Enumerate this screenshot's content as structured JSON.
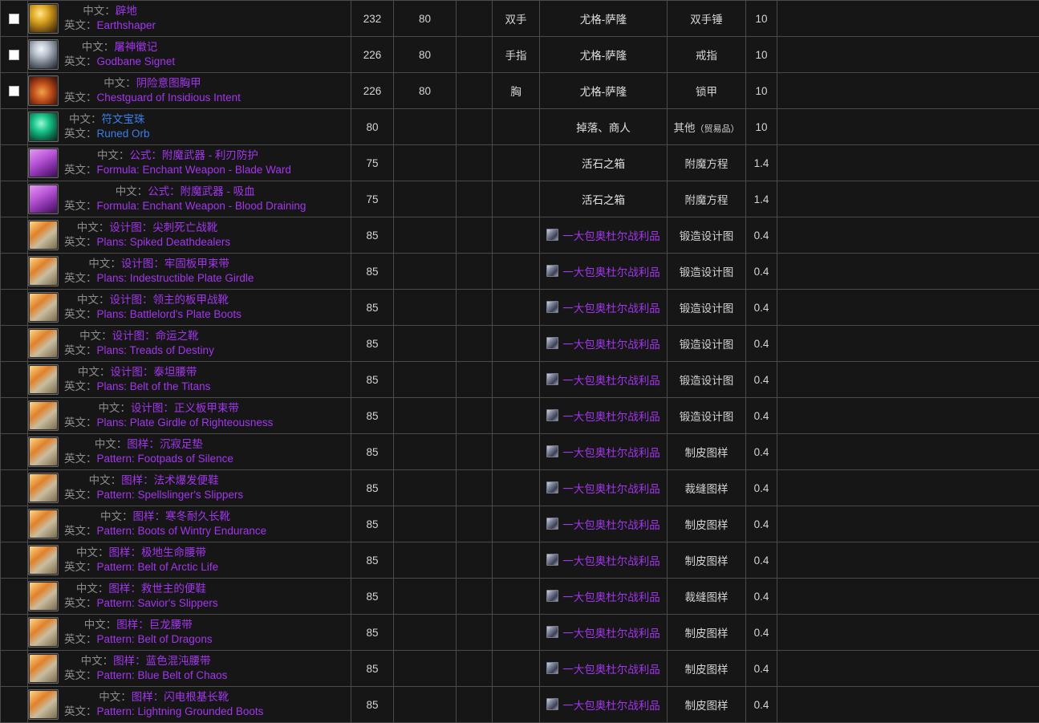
{
  "labels": {
    "cn": "中文：",
    "en": "英文："
  },
  "colors": {
    "epic": "#a335ee",
    "rare": "#3a7fe8",
    "background": "#161616",
    "border": "#4a4a4a",
    "label_gray": "#8d8d8d"
  },
  "columns": [
    "checkbox",
    "item",
    "item_level",
    "required_level",
    "blank",
    "slot",
    "source",
    "type",
    "value",
    "notes"
  ],
  "rows": [
    {
      "checkbox": true,
      "checked": false,
      "icon": "two-handed-mace-icon",
      "icon_css": "radial-gradient(circle at 38% 32%, #ffe98a 0%, #d9a21f 35%, #6d4a10 75%, #2a1d06 100%)",
      "quality": "epic",
      "name_cn": "辟地",
      "name_en": "Earthshaper",
      "item_level": "232",
      "required_level": "80",
      "blank": "",
      "slot": "双手",
      "source": "尤格-萨隆",
      "source_link": false,
      "type": "双手锤",
      "type_sub": "",
      "value": "10",
      "notes": ""
    },
    {
      "checkbox": true,
      "checked": false,
      "icon": "ring-icon",
      "icon_css": "radial-gradient(circle at 42% 30%, #f4f7fb 0%, #b9c2cc 30%, #656e78 65%, #1c2127 100%)",
      "quality": "epic",
      "name_cn": "屠神徽记",
      "name_en": "Godbane Signet",
      "item_level": "226",
      "required_level": "80",
      "blank": "",
      "slot": "手指",
      "source": "尤格-萨隆",
      "source_link": false,
      "type": "戒指",
      "type_sub": "",
      "value": "10",
      "notes": ""
    },
    {
      "checkbox": true,
      "checked": false,
      "icon": "chest-armor-icon",
      "icon_css": "radial-gradient(circle at 45% 55%, #f0a24a 0%, #c2521d 40%, #7a2a10 70%, #2a1207 100%)",
      "quality": "epic",
      "name_cn": "阴险意图胸甲",
      "name_en": "Chestguard of Insidious Intent",
      "item_level": "226",
      "required_level": "80",
      "blank": "",
      "slot": "胸",
      "source": "尤格-萨隆",
      "source_link": false,
      "type": "锁甲",
      "type_sub": "",
      "value": "10",
      "notes": ""
    },
    {
      "checkbox": false,
      "checked": false,
      "icon": "runed-orb-icon",
      "icon_css": "radial-gradient(circle at 42% 38%, #9ff7d6 0%, #19c48a 35%, #0c6a4a 70%, #08281f 100%)",
      "quality": "rare",
      "name_cn": "符文宝珠",
      "name_en": "Runed Orb",
      "item_level": "80",
      "required_level": "",
      "blank": "",
      "slot": "",
      "source": "掉落、商人",
      "source_link": false,
      "type": "其他",
      "type_sub": "（贸易品）",
      "value": "10",
      "notes": ""
    },
    {
      "checkbox": false,
      "checked": false,
      "icon": "enchanting-formula-icon",
      "icon_css": "linear-gradient(150deg, #e29bf0 0%, #b955d6 40%, #7a2a9c 72%, #3a1150 100%)",
      "quality": "epic",
      "name_cn": "公式：附魔武器 - 利刃防护",
      "name_en": "Formula: Enchant Weapon - Blade Ward",
      "item_level": "75",
      "required_level": "",
      "blank": "",
      "slot": "",
      "source": "活石之箱",
      "source_link": false,
      "type": "附魔方程",
      "type_sub": "",
      "value": "1.4",
      "notes": ""
    },
    {
      "checkbox": false,
      "checked": false,
      "icon": "enchanting-formula-icon",
      "icon_css": "linear-gradient(150deg, #e29bf0 0%, #b955d6 40%, #7a2a9c 72%, #3a1150 100%)",
      "quality": "epic",
      "name_cn": "公式：附魔武器 - 吸血",
      "name_en": "Formula: Enchant Weapon - Blood Draining",
      "item_level": "75",
      "required_level": "",
      "blank": "",
      "slot": "",
      "source": "活石之箱",
      "source_link": false,
      "type": "附魔方程",
      "type_sub": "",
      "value": "1.4",
      "notes": ""
    },
    {
      "checkbox": false,
      "checked": false,
      "icon": "blacksmithing-plans-icon",
      "icon_css": "linear-gradient(140deg, #ffd98a 0%, #e0812a 35%, #c9bda0 60%, #7a6a4c 100%)",
      "quality": "epic",
      "name_cn": "设计图：尖刺死亡战靴",
      "name_en": "Plans: Spiked Deathdealers",
      "item_level": "85",
      "required_level": "",
      "blank": "",
      "slot": "",
      "source": "一大包奥杜尔战利品",
      "source_link": true,
      "type": "锻造设计图",
      "type_sub": "",
      "value": "0.4",
      "notes": ""
    },
    {
      "checkbox": false,
      "checked": false,
      "icon": "blacksmithing-plans-icon",
      "icon_css": "linear-gradient(140deg, #ffd98a 0%, #e0812a 35%, #c9bda0 60%, #7a6a4c 100%)",
      "quality": "epic",
      "name_cn": "设计图：牢固板甲束带",
      "name_en": "Plans: Indestructible Plate Girdle",
      "item_level": "85",
      "required_level": "",
      "blank": "",
      "slot": "",
      "source": "一大包奥杜尔战利品",
      "source_link": true,
      "type": "锻造设计图",
      "type_sub": "",
      "value": "0.4",
      "notes": ""
    },
    {
      "checkbox": false,
      "checked": false,
      "icon": "blacksmithing-plans-icon",
      "icon_css": "linear-gradient(140deg, #ffd98a 0%, #e0812a 35%, #c9bda0 60%, #7a6a4c 100%)",
      "quality": "epic",
      "name_cn": "设计图：领主的板甲战靴",
      "name_en": "Plans: Battlelord's Plate Boots",
      "item_level": "85",
      "required_level": "",
      "blank": "",
      "slot": "",
      "source": "一大包奥杜尔战利品",
      "source_link": true,
      "type": "锻造设计图",
      "type_sub": "",
      "value": "0.4",
      "notes": ""
    },
    {
      "checkbox": false,
      "checked": false,
      "icon": "blacksmithing-plans-icon",
      "icon_css": "linear-gradient(140deg, #ffd98a 0%, #e0812a 35%, #c9bda0 60%, #7a6a4c 100%)",
      "quality": "epic",
      "name_cn": "设计图：命运之靴",
      "name_en": "Plans: Treads of Destiny",
      "item_level": "85",
      "required_level": "",
      "blank": "",
      "slot": "",
      "source": "一大包奥杜尔战利品",
      "source_link": true,
      "type": "锻造设计图",
      "type_sub": "",
      "value": "0.4",
      "notes": ""
    },
    {
      "checkbox": false,
      "checked": false,
      "icon": "blacksmithing-plans-icon",
      "icon_css": "linear-gradient(140deg, #ffd98a 0%, #e0812a 35%, #c9bda0 60%, #7a6a4c 100%)",
      "quality": "epic",
      "name_cn": "设计图：泰坦腰带",
      "name_en": "Plans: Belt of the Titans",
      "item_level": "85",
      "required_level": "",
      "blank": "",
      "slot": "",
      "source": "一大包奥杜尔战利品",
      "source_link": true,
      "type": "锻造设计图",
      "type_sub": "",
      "value": "0.4",
      "notes": ""
    },
    {
      "checkbox": false,
      "checked": false,
      "icon": "blacksmithing-plans-icon",
      "icon_css": "linear-gradient(140deg, #ffd98a 0%, #e0812a 35%, #c9bda0 60%, #7a6a4c 100%)",
      "quality": "epic",
      "name_cn": "设计图：正义板甲束带",
      "name_en": "Plans: Plate Girdle of Righteousness",
      "item_level": "85",
      "required_level": "",
      "blank": "",
      "slot": "",
      "source": "一大包奥杜尔战利品",
      "source_link": true,
      "type": "锻造设计图",
      "type_sub": "",
      "value": "0.4",
      "notes": ""
    },
    {
      "checkbox": false,
      "checked": false,
      "icon": "leatherworking-pattern-icon",
      "icon_css": "linear-gradient(140deg, #ffd98a 0%, #e0812a 35%, #c9bda0 60%, #7a6a4c 100%)",
      "quality": "epic",
      "name_cn": "图样：沉寂足垫",
      "name_en": "Pattern: Footpads of Silence",
      "item_level": "85",
      "required_level": "",
      "blank": "",
      "slot": "",
      "source": "一大包奥杜尔战利品",
      "source_link": true,
      "type": "制皮图样",
      "type_sub": "",
      "value": "0.4",
      "notes": ""
    },
    {
      "checkbox": false,
      "checked": false,
      "icon": "tailoring-pattern-icon",
      "icon_css": "linear-gradient(140deg, #ffd98a 0%, #e0812a 35%, #c9bda0 60%, #7a6a4c 100%)",
      "quality": "epic",
      "name_cn": "图样：法术爆发便鞋",
      "name_en": "Pattern: Spellslinger's Slippers",
      "item_level": "85",
      "required_level": "",
      "blank": "",
      "slot": "",
      "source": "一大包奥杜尔战利品",
      "source_link": true,
      "type": "裁缝图样",
      "type_sub": "",
      "value": "0.4",
      "notes": ""
    },
    {
      "checkbox": false,
      "checked": false,
      "icon": "leatherworking-pattern-icon",
      "icon_css": "linear-gradient(140deg, #ffd98a 0%, #e0812a 35%, #c9bda0 60%, #7a6a4c 100%)",
      "quality": "epic",
      "name_cn": "图样：寒冬耐久长靴",
      "name_en": "Pattern: Boots of Wintry Endurance",
      "item_level": "85",
      "required_level": "",
      "blank": "",
      "slot": "",
      "source": "一大包奥杜尔战利品",
      "source_link": true,
      "type": "制皮图样",
      "type_sub": "",
      "value": "0.4",
      "notes": ""
    },
    {
      "checkbox": false,
      "checked": false,
      "icon": "leatherworking-pattern-icon",
      "icon_css": "linear-gradient(140deg, #ffd98a 0%, #e0812a 35%, #c9bda0 60%, #7a6a4c 100%)",
      "quality": "epic",
      "name_cn": "图样：极地生命腰带",
      "name_en": "Pattern: Belt of Arctic Life",
      "item_level": "85",
      "required_level": "",
      "blank": "",
      "slot": "",
      "source": "一大包奥杜尔战利品",
      "source_link": true,
      "type": "制皮图样",
      "type_sub": "",
      "value": "0.4",
      "notes": ""
    },
    {
      "checkbox": false,
      "checked": false,
      "icon": "tailoring-pattern-icon",
      "icon_css": "linear-gradient(140deg, #ffd98a 0%, #e0812a 35%, #c9bda0 60%, #7a6a4c 100%)",
      "quality": "epic",
      "name_cn": "图样：救世主的便鞋",
      "name_en": "Pattern: Savior's Slippers",
      "item_level": "85",
      "required_level": "",
      "blank": "",
      "slot": "",
      "source": "一大包奥杜尔战利品",
      "source_link": true,
      "type": "裁缝图样",
      "type_sub": "",
      "value": "0.4",
      "notes": ""
    },
    {
      "checkbox": false,
      "checked": false,
      "icon": "leatherworking-pattern-icon",
      "icon_css": "linear-gradient(140deg, #ffd98a 0%, #e0812a 35%, #c9bda0 60%, #7a6a4c 100%)",
      "quality": "epic",
      "name_cn": "图样：巨龙腰带",
      "name_en": "Pattern: Belt of Dragons",
      "item_level": "85",
      "required_level": "",
      "blank": "",
      "slot": "",
      "source": "一大包奥杜尔战利品",
      "source_link": true,
      "type": "制皮图样",
      "type_sub": "",
      "value": "0.4",
      "notes": ""
    },
    {
      "checkbox": false,
      "checked": false,
      "icon": "leatherworking-pattern-icon",
      "icon_css": "linear-gradient(140deg, #ffd98a 0%, #e0812a 35%, #c9bda0 60%, #7a6a4c 100%)",
      "quality": "epic",
      "name_cn": "图样：蓝色混沌腰带",
      "name_en": "Pattern: Blue Belt of Chaos",
      "item_level": "85",
      "required_level": "",
      "blank": "",
      "slot": "",
      "source": "一大包奥杜尔战利品",
      "source_link": true,
      "type": "制皮图样",
      "type_sub": "",
      "value": "0.4",
      "notes": ""
    },
    {
      "checkbox": false,
      "checked": false,
      "icon": "leatherworking-pattern-icon",
      "icon_css": "linear-gradient(140deg, #ffd98a 0%, #e0812a 35%, #c9bda0 60%, #7a6a4c 100%)",
      "quality": "epic",
      "name_cn": "图样：闪电根基长靴",
      "name_en": "Pattern: Lightning Grounded Boots",
      "item_level": "85",
      "required_level": "",
      "blank": "",
      "slot": "",
      "source": "一大包奥杜尔战利品",
      "source_link": true,
      "type": "制皮图样",
      "type_sub": "",
      "value": "0.4",
      "notes": ""
    }
  ]
}
